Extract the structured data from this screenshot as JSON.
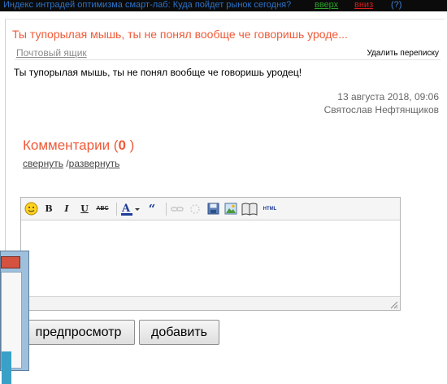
{
  "topbar": {
    "title": "Индекс интрадей оптимизма смарт-лаб: Куда пойдет рынок сегодня?",
    "up": "вверх",
    "down": "вниз",
    "help": "(?)"
  },
  "message": {
    "title": "Ты тупорылая мышь, ты не понял вообще че говоришь уроде...",
    "mailbox_link": "Почтовый ящик",
    "delete_link": "Удалить переписку",
    "body": "Ты тупорылая мышь, ты не понял вообще че говоришь уродец!",
    "date": "13 августа 2018, 09:06",
    "author": "Святослав Нефтянщиков"
  },
  "comments": {
    "label": "Комментарии (",
    "count": "0",
    "close": " )",
    "collapse": "свернуть",
    "separator": " /",
    "expand": "развернуть"
  },
  "editor": {
    "toolbar": [
      "smiley-icon",
      "bold-icon",
      "italic-icon",
      "underline-icon",
      "strikethrough-icon",
      "font-color-icon",
      "quote-icon",
      "link-icon",
      "unlink-icon",
      "save-icon",
      "image-icon",
      "book-icon",
      "html-icon"
    ]
  },
  "buttons": {
    "preview": "предпросмотр",
    "add": "добавить"
  },
  "colors": {
    "accent": "#ef5a38",
    "topbar_bg": "#0b0b0b",
    "link_blue": "#2e73c8"
  }
}
